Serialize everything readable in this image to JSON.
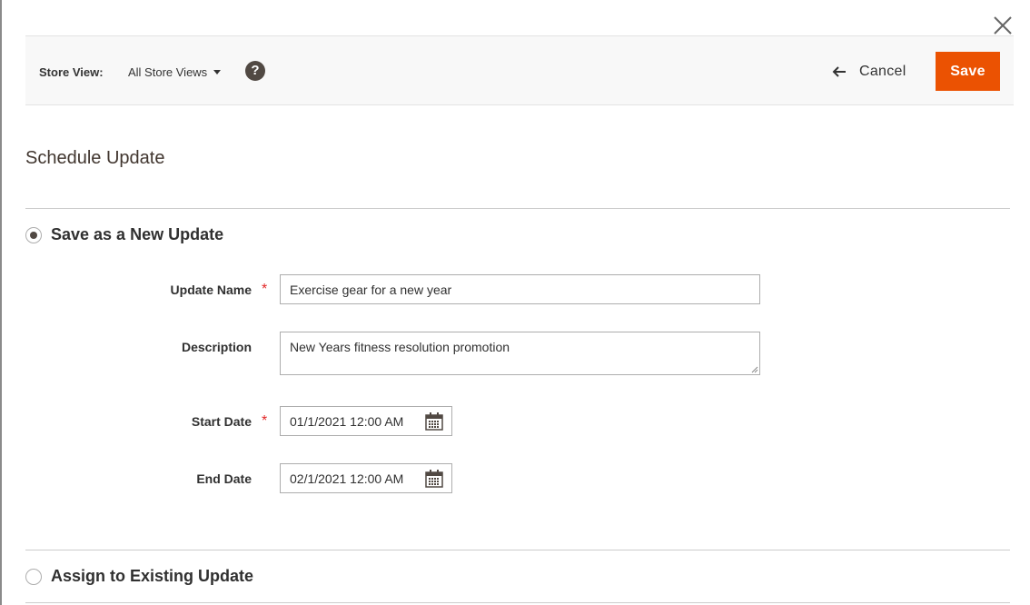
{
  "toolbar": {
    "store_view_label": "Store View:",
    "store_view_value": "All Store Views",
    "help_symbol": "?",
    "cancel_label": "Cancel",
    "save_label": "Save"
  },
  "page": {
    "title": "Schedule Update"
  },
  "new_update": {
    "option_label": "Save as a New Update",
    "selected": true,
    "fields": {
      "update_name": {
        "label": "Update Name",
        "required": "*",
        "value": "Exercise gear for a new year"
      },
      "description": {
        "label": "Description",
        "value": "New Years fitness resolution promotion"
      },
      "start_date": {
        "label": "Start Date",
        "required": "*",
        "value": "01/1/2021 12:00 AM"
      },
      "end_date": {
        "label": "End Date",
        "value": "02/1/2021 12:00 AM"
      }
    }
  },
  "existing_update": {
    "option_label": "Assign to Existing Update",
    "selected": false
  },
  "colors": {
    "accent": "#eb5202",
    "required": "#e22626",
    "toolbar_bg": "#f8f8f8",
    "text": "#303030"
  },
  "icons": {
    "close": "close-icon",
    "help": "help-icon",
    "back": "arrow-left-icon",
    "calendar": "calendar-icon",
    "dropdown": "caret-down-icon"
  }
}
